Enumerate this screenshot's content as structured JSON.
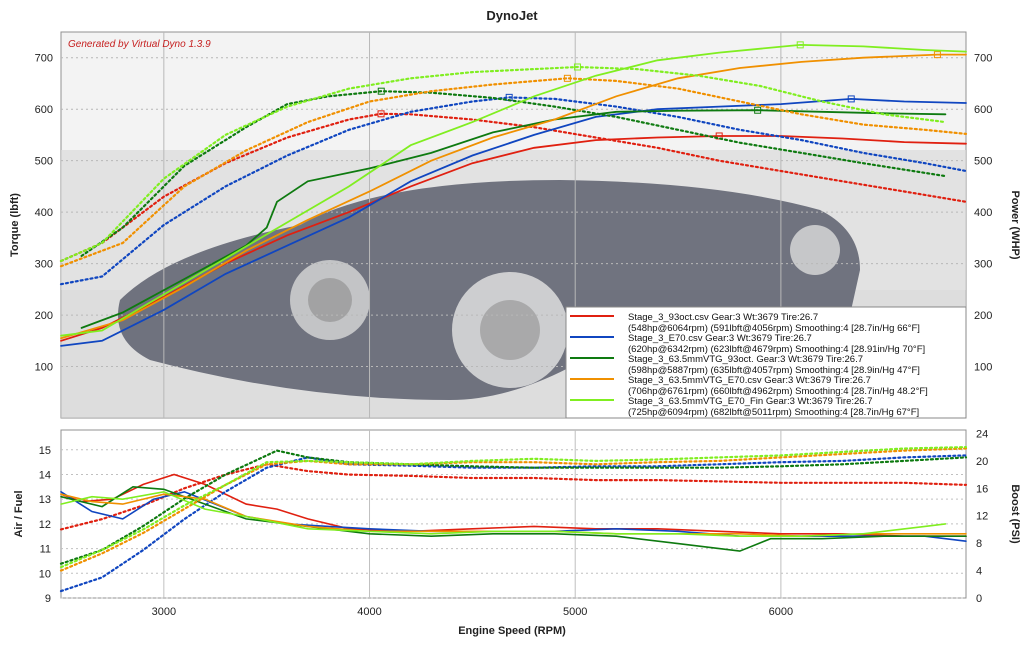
{
  "chart_data": [
    {
      "type": "line",
      "title": "DynoJet",
      "watermark": "Generated by Virtual Dyno 1.3.9",
      "xlabel": "",
      "ylabel": "Torque (lbft)",
      "y2label": "Power (WHP)",
      "xlim": [
        2500,
        6900
      ],
      "ylim": [
        0,
        750
      ],
      "y2lim": [
        0,
        750
      ],
      "yticks": [
        100,
        200,
        300,
        400,
        500,
        600,
        700
      ],
      "y2ticks": [
        100,
        200,
        300,
        400,
        500,
        600,
        700
      ],
      "grid": true,
      "legend_position": "bottom-right",
      "legend": [
        {
          "line1": "Stage_3_93oct.csv Gear:3 Wt:3679 Tire:26.7",
          "line2": "(548hp@6064rpm) (591lbft@4056rpm) Smoothing:4 [28.7in/Hg 66°F]",
          "color": "#e02010"
        },
        {
          "line1": "Stage_3_E70.csv Gear:3 Wt:3679 Tire:26.7",
          "line2": "(620hp@6342rpm) (623lbft@4679rpm) Smoothing:4 [28.91in/Hg 70°F]",
          "color": "#1046c0"
        },
        {
          "line1": "Stage_3_63.5mmVTG_93oct. Gear:3 Wt:3679 Tire:26.7",
          "line2": "(598hp@5887rpm) (635lbft@4057rpm) Smoothing:4 [28.9in/Hg 47°F]",
          "color": "#0e7a10"
        },
        {
          "line1": "Stage_3_63.5mmVTG_E70.csv Gear:3 Wt:3679 Tire:26.7",
          "line2": "(706hp@6761rpm) (660lbft@4962rpm) Smoothing:4 [28.7in/Hg 48.2°F]",
          "color": "#f09000"
        },
        {
          "line1": "Stage_3_63.5mmVTG_E70_Fin Gear:3 Wt:3679 Tire:26.7",
          "line2": "(725hp@6094rpm) (682lbft@5011rpm) Smoothing:4 [28.7in/Hg 67°F]",
          "color": "#80ee20"
        }
      ],
      "series": [
        {
          "name": "Stage_3_93oct.csv",
          "kind": "power",
          "color": "#e02010",
          "x": [
            2500,
            2700,
            3000,
            3300,
            3600,
            3900,
            4200,
            4500,
            4800,
            5100,
            5400,
            5700,
            6000,
            6300,
            6600,
            6900
          ],
          "y": [
            150,
            175,
            235,
            300,
            355,
            400,
            450,
            495,
            525,
            540,
            545,
            548,
            548,
            543,
            536,
            533
          ]
        },
        {
          "name": "Stage_3_93oct.csv",
          "kind": "torque",
          "color": "#e02010",
          "x": [
            2500,
            2700,
            3000,
            3300,
            3600,
            3900,
            4056,
            4200,
            4500,
            4800,
            5100,
            5400,
            5700,
            6000,
            6300,
            6600,
            6900
          ],
          "y": [
            305,
            340,
            430,
            495,
            545,
            580,
            591,
            590,
            580,
            565,
            545,
            525,
            500,
            480,
            460,
            440,
            420
          ]
        },
        {
          "name": "Stage_3_E70.csv",
          "kind": "power",
          "color": "#1046c0",
          "x": [
            2500,
            2700,
            3000,
            3300,
            3600,
            3900,
            4200,
            4500,
            4800,
            5100,
            5400,
            5700,
            6000,
            6342,
            6600,
            6900
          ],
          "y": [
            140,
            150,
            210,
            280,
            335,
            390,
            460,
            510,
            550,
            585,
            600,
            605,
            610,
            620,
            615,
            612
          ]
        },
        {
          "name": "Stage_3_E70.csv",
          "kind": "torque",
          "color": "#1046c0",
          "x": [
            2500,
            2700,
            3000,
            3300,
            3600,
            3900,
            4200,
            4500,
            4679,
            4900,
            5200,
            5500,
            5800,
            6100,
            6400,
            6700,
            6900
          ],
          "y": [
            260,
            275,
            375,
            450,
            510,
            560,
            595,
            615,
            623,
            620,
            605,
            585,
            560,
            540,
            515,
            495,
            480
          ]
        },
        {
          "name": "Stage_3_63.5mmVTG_93oct.",
          "kind": "power",
          "color": "#0e7a10",
          "x": [
            2600,
            2800,
            3100,
            3400,
            3500,
            3550,
            3700,
            4000,
            4300,
            4600,
            4900,
            5200,
            5500,
            5887,
            6200,
            6500,
            6800
          ],
          "y": [
            175,
            205,
            270,
            335,
            370,
            420,
            460,
            485,
            515,
            555,
            580,
            595,
            597,
            598,
            595,
            592,
            590
          ]
        },
        {
          "name": "Stage_3_63.5mmVTG_93oct.",
          "kind": "torque",
          "color": "#0e7a10",
          "x": [
            2600,
            2800,
            3100,
            3400,
            3600,
            3800,
            4057,
            4300,
            4600,
            4900,
            5200,
            5500,
            5800,
            6100,
            6400,
            6800
          ],
          "y": [
            315,
            370,
            490,
            565,
            610,
            625,
            635,
            632,
            622,
            605,
            585,
            560,
            535,
            515,
            495,
            470
          ]
        },
        {
          "name": "Stage_3_63.5mmVTG_E70.csv",
          "kind": "power",
          "color": "#f09000",
          "x": [
            2500,
            2800,
            3100,
            3400,
            3700,
            4000,
            4300,
            4600,
            4900,
            5200,
            5500,
            5800,
            6100,
            6400,
            6761,
            6900
          ],
          "y": [
            155,
            190,
            255,
            325,
            385,
            440,
            500,
            545,
            580,
            625,
            660,
            680,
            692,
            700,
            706,
            706
          ]
        },
        {
          "name": "Stage_3_63.5mmVTG_E70.csv",
          "kind": "torque",
          "color": "#f09000",
          "x": [
            2500,
            2800,
            3100,
            3400,
            3700,
            4000,
            4300,
            4600,
            4962,
            5200,
            5500,
            5800,
            6100,
            6400,
            6700,
            6900
          ],
          "y": [
            295,
            340,
            450,
            520,
            575,
            615,
            635,
            648,
            660,
            655,
            640,
            615,
            590,
            570,
            560,
            552
          ]
        },
        {
          "name": "Stage_3_63.5mmVTG_E70_Fin",
          "kind": "power",
          "color": "#80ee20",
          "x": [
            2500,
            2700,
            3000,
            3300,
            3600,
            3900,
            4200,
            4500,
            4800,
            5100,
            5400,
            5700,
            6094,
            6400,
            6700,
            6900
          ],
          "y": [
            160,
            170,
            240,
            310,
            380,
            450,
            530,
            575,
            625,
            665,
            695,
            710,
            725,
            722,
            715,
            712
          ]
        },
        {
          "name": "Stage_3_63.5mmVTG_E70_Fin",
          "kind": "torque",
          "color": "#80ee20",
          "x": [
            2500,
            2700,
            3000,
            3300,
            3600,
            3900,
            4200,
            4500,
            4800,
            5011,
            5300,
            5600,
            5900,
            6200,
            6500,
            6800
          ],
          "y": [
            305,
            340,
            465,
            550,
            605,
            640,
            660,
            672,
            678,
            682,
            678,
            665,
            645,
            615,
            590,
            575
          ]
        }
      ]
    },
    {
      "type": "line",
      "xlabel": "Engine Speed (RPM)",
      "ylabel": "Air / Fuel",
      "y2label": "Boost (PSI)",
      "xlim": [
        2500,
        6900
      ],
      "ylim": [
        9,
        15.8
      ],
      "y2lim": [
        0,
        24.5
      ],
      "xticks": [
        3000,
        4000,
        5000,
        6000
      ],
      "yticks": [
        9,
        10,
        11,
        12,
        13,
        14,
        15
      ],
      "y2ticks": [
        0,
        4,
        8,
        12,
        16,
        20,
        24
      ],
      "grid": true,
      "series": [
        {
          "name": "Stage_3_93oct.csv",
          "kind": "afr",
          "color": "#e02010",
          "x": [
            2500,
            2600,
            2750,
            2900,
            3050,
            3200,
            3400,
            3550,
            3700,
            3900,
            4200,
            4500,
            4800,
            5100,
            5400,
            5700,
            6000,
            6300,
            6600,
            6900
          ],
          "y": [
            13.2,
            12.9,
            13.0,
            13.6,
            14.0,
            13.6,
            12.8,
            12.6,
            12.2,
            11.8,
            11.7,
            11.8,
            11.9,
            11.8,
            11.8,
            11.7,
            11.6,
            11.6,
            11.5,
            11.5
          ]
        },
        {
          "name": "Stage_3_93oct.csv",
          "kind": "boost",
          "color": "#e02010",
          "x": [
            2500,
            2700,
            2900,
            3100,
            3300,
            3500,
            3700,
            3900,
            4200,
            4500,
            4800,
            5100,
            5400,
            5700,
            6000,
            6300,
            6600,
            6900
          ],
          "y": [
            10,
            11.5,
            13.5,
            16,
            18,
            19.5,
            18.5,
            18,
            17.8,
            17.5,
            17.5,
            17.2,
            17.2,
            17,
            16.8,
            16.8,
            16.8,
            16.5
          ]
        },
        {
          "name": "Stage_3_E70.csv",
          "kind": "afr",
          "color": "#1046c0",
          "x": [
            2500,
            2650,
            2800,
            2950,
            3100,
            3250,
            3400,
            3600,
            3800,
            4000,
            4300,
            4600,
            4900,
            5200,
            5500,
            5800,
            6100,
            6400,
            6700,
            6900
          ],
          "y": [
            13.3,
            12.5,
            12.2,
            13.0,
            13.3,
            12.8,
            12.3,
            12.0,
            11.9,
            11.8,
            11.7,
            11.7,
            11.7,
            11.8,
            11.7,
            11.5,
            11.5,
            11.5,
            11.5,
            11.3
          ]
        },
        {
          "name": "Stage_3_E70.csv",
          "kind": "boost",
          "color": "#1046c0",
          "x": [
            2500,
            2700,
            2900,
            3100,
            3300,
            3500,
            3700,
            3900,
            4200,
            4500,
            4800,
            5100,
            5400,
            5700,
            6000,
            6300,
            6600,
            6900
          ],
          "y": [
            1,
            3,
            7,
            11.5,
            15.5,
            19,
            20.5,
            19.5,
            19.3,
            19,
            19,
            19.2,
            19.2,
            19.5,
            19.8,
            20,
            20.5,
            20.8
          ]
        },
        {
          "name": "Stage_3_63.5mmVTG_93oct.",
          "kind": "afr",
          "color": "#0e7a10",
          "x": [
            2500,
            2700,
            2850,
            3000,
            3200,
            3400,
            3700,
            4000,
            4300,
            4600,
            4900,
            5200,
            5500,
            5700,
            5800,
            5950,
            6200,
            6500,
            6900
          ],
          "y": [
            13.1,
            12.7,
            13.5,
            13.4,
            12.8,
            12.2,
            11.9,
            11.6,
            11.5,
            11.6,
            11.6,
            11.5,
            11.2,
            11.0,
            10.9,
            11.4,
            11.4,
            11.5,
            11.5
          ]
        },
        {
          "name": "Stage_3_63.5mmVTG_93oct.",
          "kind": "boost",
          "color": "#0e7a10",
          "x": [
            2500,
            2700,
            2900,
            3100,
            3300,
            3550,
            3700,
            3900,
            4200,
            4500,
            4800,
            5100,
            5400,
            5700,
            6000,
            6300,
            6600,
            6900
          ],
          "y": [
            5,
            7,
            10.5,
            14.5,
            18,
            21.5,
            20.5,
            19.8,
            19.5,
            19.2,
            19,
            19,
            19,
            19,
            19.2,
            19.5,
            20,
            20.5
          ]
        },
        {
          "name": "Stage_3_63.5mmVTG_E70.csv",
          "kind": "afr",
          "color": "#f09000",
          "x": [
            2500,
            2650,
            2800,
            3000,
            3200,
            3400,
            3700,
            4000,
            4300,
            4600,
            4900,
            5200,
            5500,
            5800,
            6100,
            6400,
            6700,
            6900
          ],
          "y": [
            13.2,
            12.9,
            12.8,
            13.2,
            13.0,
            12.3,
            11.9,
            11.7,
            11.7,
            11.7,
            11.7,
            11.6,
            11.6,
            11.6,
            11.5,
            11.6,
            11.6,
            11.6
          ]
        },
        {
          "name": "Stage_3_63.5mmVTG_E70.csv",
          "kind": "boost",
          "color": "#f09000",
          "x": [
            2500,
            2700,
            2900,
            3100,
            3300,
            3500,
            3700,
            3900,
            4200,
            4500,
            4800,
            5100,
            5400,
            5700,
            6000,
            6300,
            6600,
            6900
          ],
          "y": [
            4,
            6.5,
            9.5,
            13,
            16.5,
            19.5,
            20,
            19.5,
            19.5,
            19.8,
            19.8,
            19.5,
            19.8,
            20,
            20.5,
            21,
            21.5,
            21.8
          ]
        },
        {
          "name": "Stage_3_63.5mmVTG_E70_Fin",
          "kind": "afr",
          "color": "#80ee20",
          "x": [
            2500,
            2650,
            2800,
            3000,
            3200,
            3400,
            3700,
            4000,
            4300,
            4600,
            4900,
            5200,
            5500,
            5800,
            6100,
            6400,
            6700,
            6800
          ],
          "y": [
            12.8,
            13.1,
            13.0,
            13.3,
            12.6,
            12.3,
            11.8,
            11.7,
            11.6,
            11.7,
            11.7,
            11.6,
            11.6,
            11.5,
            11.5,
            11.6,
            11.9,
            12.0
          ]
        },
        {
          "name": "Stage_3_63.5mmVTG_E70_Fin",
          "kind": "boost",
          "color": "#80ee20",
          "x": [
            2500,
            2700,
            2900,
            3100,
            3300,
            3500,
            3700,
            3900,
            4200,
            4500,
            4800,
            5100,
            5400,
            5700,
            6000,
            6300,
            6600,
            6900
          ],
          "y": [
            4.5,
            7,
            10,
            13.5,
            16.5,
            19.8,
            20,
            19.8,
            19.5,
            20,
            20.3,
            20,
            20.2,
            20.5,
            20.8,
            21.3,
            21.8,
            22
          ]
        }
      ]
    }
  ]
}
